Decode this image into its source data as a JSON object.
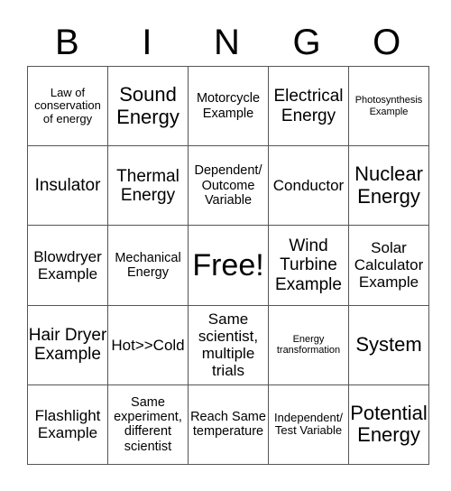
{
  "header": [
    "B",
    "I",
    "N",
    "G",
    "O"
  ],
  "board": [
    [
      "Law of conservation of energy",
      "Sound Energy",
      "Motorcycle Example",
      "Electrical Energy",
      "Photosynthesis Example"
    ],
    [
      "Insulator",
      "Thermal Energy",
      "Dependent/ Outcome Variable",
      "Conductor",
      "Nuclear Energy"
    ],
    [
      "Blowdryer Example",
      "Mechanical Energy",
      "Free!",
      "Wind Turbine Example",
      "Solar Calculator Example"
    ],
    [
      "Hair Dryer Example",
      "Hot>>Cold",
      "Same scientist, multiple trials",
      "Energy transformation",
      "System"
    ],
    [
      "Flashlight Example",
      "Same experiment, different scientist",
      "Reach Same temperature",
      "Independent/ Test Variable",
      "Potential Energy"
    ]
  ]
}
